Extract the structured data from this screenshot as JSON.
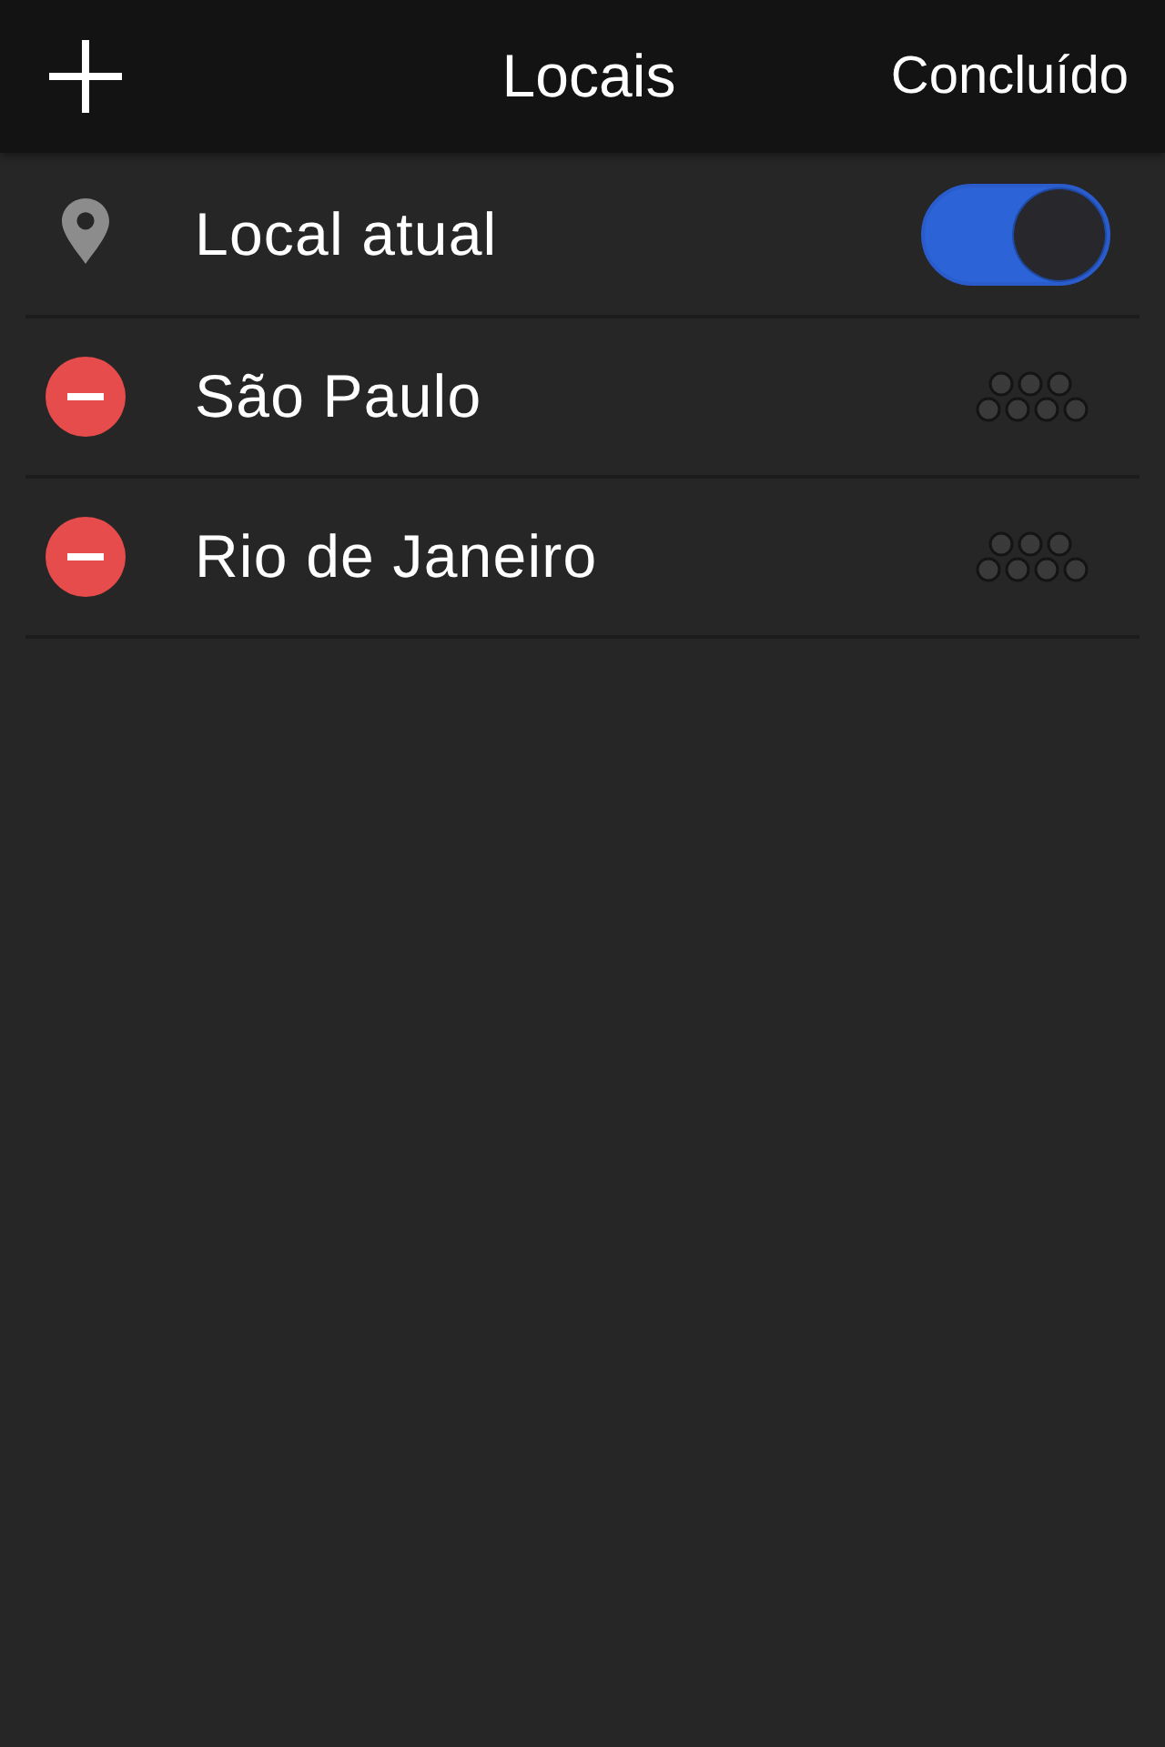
{
  "navigation_bar": {
    "title": "Locais",
    "done_button": "Concluído"
  },
  "current_location": {
    "label": "Local atual",
    "on": true
  },
  "locations": [
    {
      "name": "São Paulo"
    },
    {
      "name": "Rio de Janeiro"
    }
  ]
}
